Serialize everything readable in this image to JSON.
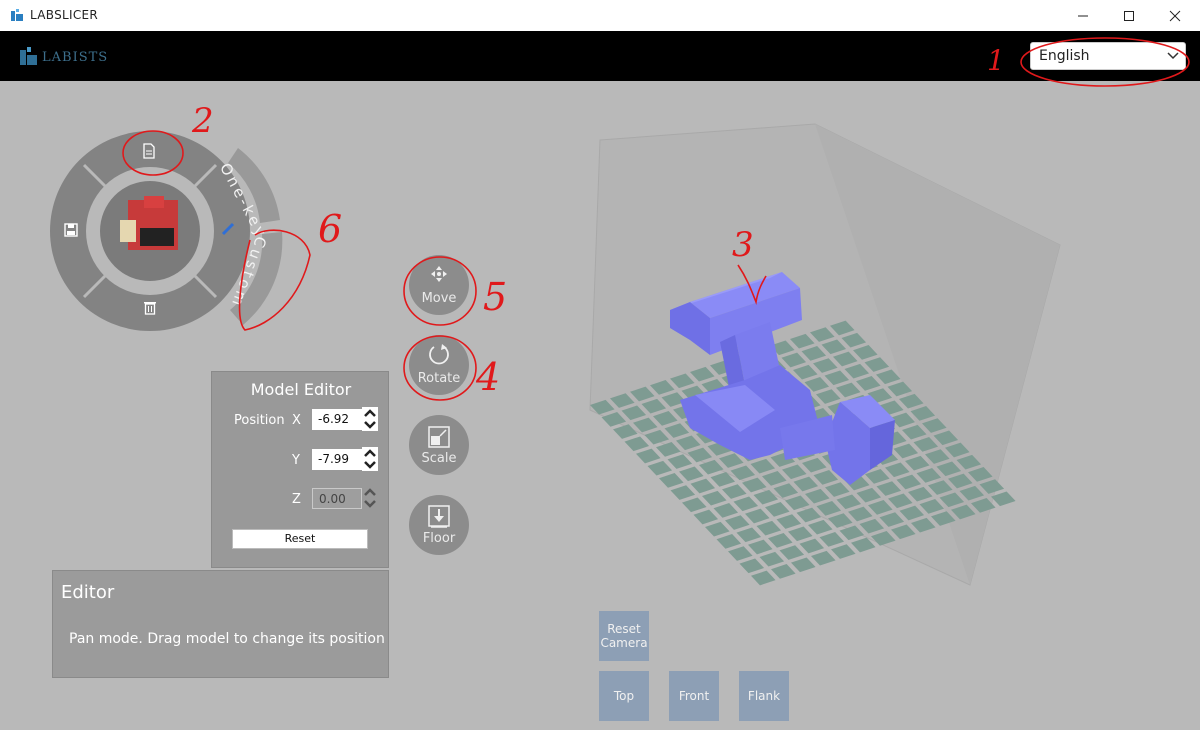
{
  "window": {
    "title": "LABSLICER",
    "controls": [
      "minimize",
      "maximize",
      "close"
    ]
  },
  "header": {
    "logo_text": "LABISTS",
    "language": {
      "selected": "English"
    }
  },
  "radial_menu": {
    "one_key_label": "One-key",
    "custom_label": "Custom",
    "icons": [
      "file-icon",
      "save-icon",
      "trash-icon",
      "pencil-icon"
    ]
  },
  "tools": {
    "move": "Move",
    "rotate": "Rotate",
    "scale": "Scale",
    "floor": "Floor"
  },
  "model_editor": {
    "title": "Model Editor",
    "position_label": "Position",
    "x_label": "X",
    "y_label": "Y",
    "z_label": "Z",
    "x_value": "-6.92",
    "y_value": "-7.99",
    "z_value": "0.00",
    "reset_label": "Reset"
  },
  "editor": {
    "title": "Editor",
    "message": "Pan mode. Drag model to change its position"
  },
  "camera": {
    "reset": "Reset Camera",
    "top": "Top",
    "front": "Front",
    "flank": "Flank"
  },
  "annotations": [
    "1",
    "2",
    "3",
    "4",
    "5",
    "6"
  ],
  "colors": {
    "background": "#b9b9b9",
    "header": "#000000",
    "model": "#7f80f2",
    "bed": "#7e9b92",
    "camera_button": "#8d9fb5",
    "annotation": "#e0191b"
  }
}
